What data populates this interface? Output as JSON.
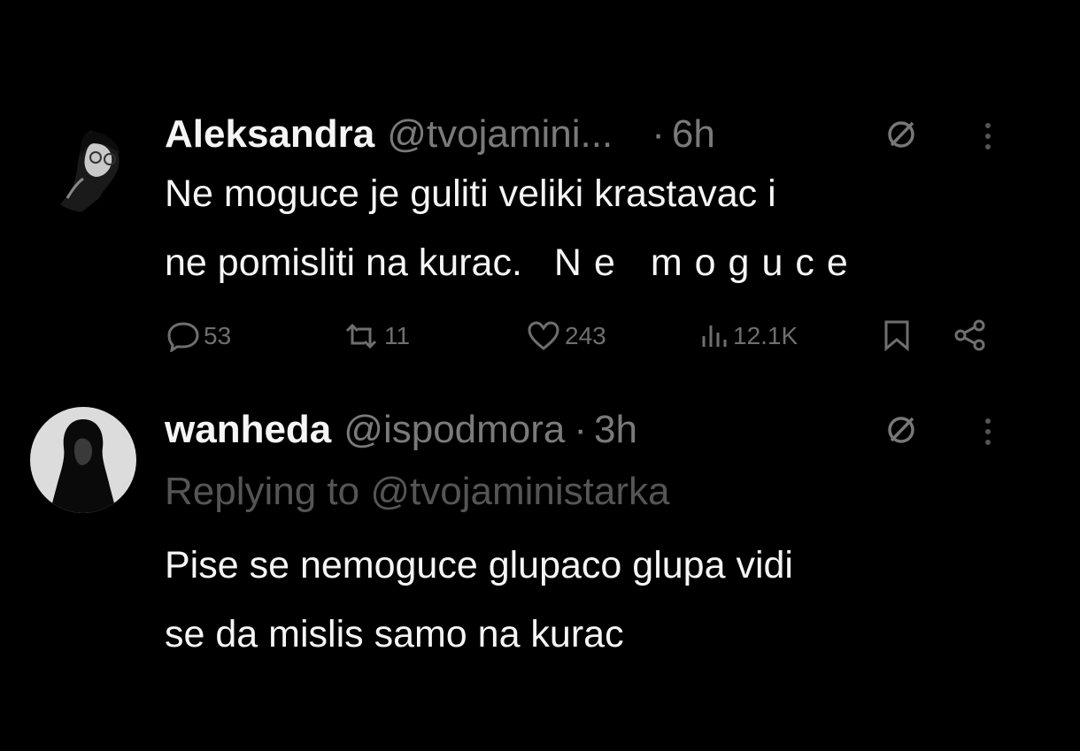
{
  "tweets": [
    {
      "name": "Aleksandra",
      "handle": "@tvojamini...",
      "separator": "·",
      "time": "6h",
      "text_line1": "Ne moguce je guliti veliki krastavac i",
      "text_line2_a": "ne pomisliti na kurac.",
      "text_line2_b": "Ne moguce",
      "actions": {
        "replies": "53",
        "retweets": "11",
        "likes": "243",
        "views": "12.1K"
      }
    },
    {
      "name": "wanheda",
      "handle": "@ispodmora",
      "separator": "·",
      "time": "3h",
      "replying_to": "Replying to @tvojaministarka",
      "text_line1": "Pise se nemoguce glupaco glupa vidi",
      "text_line2": "se da mislis samo na kurac"
    }
  ],
  "icons": {
    "grok": "grok-icon",
    "more": "more-icon",
    "reply": "reply-icon",
    "retweet": "retweet-icon",
    "like": "heart-icon",
    "views": "views-icon",
    "bookmark": "bookmark-icon",
    "share": "share-icon"
  },
  "colors": {
    "background": "#000000",
    "text": "#f5f5f5",
    "muted": "#7a7a7a",
    "reply_muted": "#555555"
  }
}
